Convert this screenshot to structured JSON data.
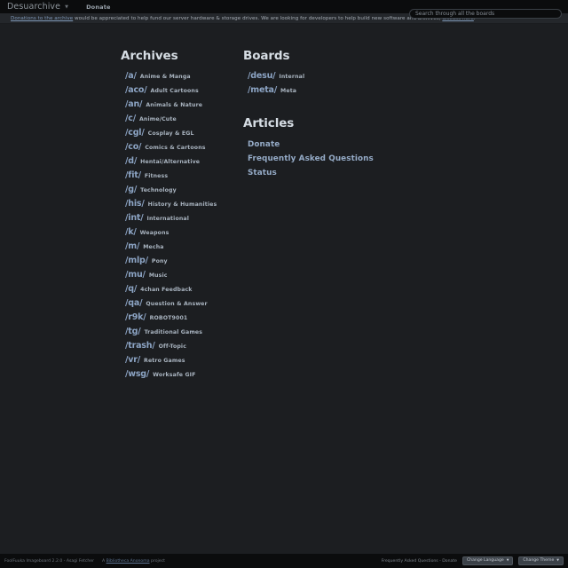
{
  "topbar": {
    "brand": "Desuarchive",
    "brand_caret_icon": "chevron-down-icon",
    "nav_donate": "Donate",
    "search_placeholder": "Search through all the boards",
    "search_value": ""
  },
  "announcement": {
    "link_text": "Donations to the archive",
    "body_before": " would be appreciated to help fund our server hardware & storage drives. We are looking for developers to help build new software and archives, ",
    "link2_text": "discuss here",
    "body_after": "."
  },
  "archives": {
    "title": "Archives",
    "boards": [
      {
        "short": "/a/",
        "desc": "Anime & Manga"
      },
      {
        "short": "/aco/",
        "desc": "Adult Cartoons"
      },
      {
        "short": "/an/",
        "desc": "Animals & Nature"
      },
      {
        "short": "/c/",
        "desc": "Anime/Cute"
      },
      {
        "short": "/cgl/",
        "desc": "Cosplay & EGL"
      },
      {
        "short": "/co/",
        "desc": "Comics & Cartoons"
      },
      {
        "short": "/d/",
        "desc": "Hentai/Alternative"
      },
      {
        "short": "/fit/",
        "desc": "Fitness"
      },
      {
        "short": "/g/",
        "desc": "Technology"
      },
      {
        "short": "/his/",
        "desc": "History & Humanities"
      },
      {
        "short": "/int/",
        "desc": "International"
      },
      {
        "short": "/k/",
        "desc": "Weapons"
      },
      {
        "short": "/m/",
        "desc": "Mecha"
      },
      {
        "short": "/mlp/",
        "desc": "Pony"
      },
      {
        "short": "/mu/",
        "desc": "Music"
      },
      {
        "short": "/q/",
        "desc": "4chan Feedback"
      },
      {
        "short": "/qa/",
        "desc": "Question & Answer"
      },
      {
        "short": "/r9k/",
        "desc": "ROBOT9001"
      },
      {
        "short": "/tg/",
        "desc": "Traditional Games"
      },
      {
        "short": "/trash/",
        "desc": "Off-Topic"
      },
      {
        "short": "/vr/",
        "desc": "Retro Games"
      },
      {
        "short": "/wsg/",
        "desc": "Worksafe GIF"
      }
    ]
  },
  "boards": {
    "title": "Boards",
    "items": [
      {
        "short": "/desu/",
        "desc": "Internal"
      },
      {
        "short": "/meta/",
        "desc": "Meta"
      }
    ]
  },
  "articles": {
    "title": "Articles",
    "items": [
      {
        "label": "Donate"
      },
      {
        "label": "Frequently Asked Questions"
      },
      {
        "label": "Status"
      }
    ]
  },
  "footer": {
    "software": "FoolFuuka Imageboard 2.2.0 - Asagi Fetcher",
    "project_before": "A ",
    "project_link": "Bibliotheca Anonoma",
    "project_after": " project",
    "meta_links": "Frequently Asked Questions - Donate",
    "language_button": "Change Language",
    "theme_button": "Change Theme",
    "caret_icon": "chevron-down-icon"
  },
  "colors": {
    "page_bg": "#1c1e21",
    "topbar_bg": "#0b0c0d",
    "announce_bg": "#24272b",
    "board_short": "#8ca4c4",
    "link": "#7f98b8",
    "heading": "#d6dde4"
  }
}
